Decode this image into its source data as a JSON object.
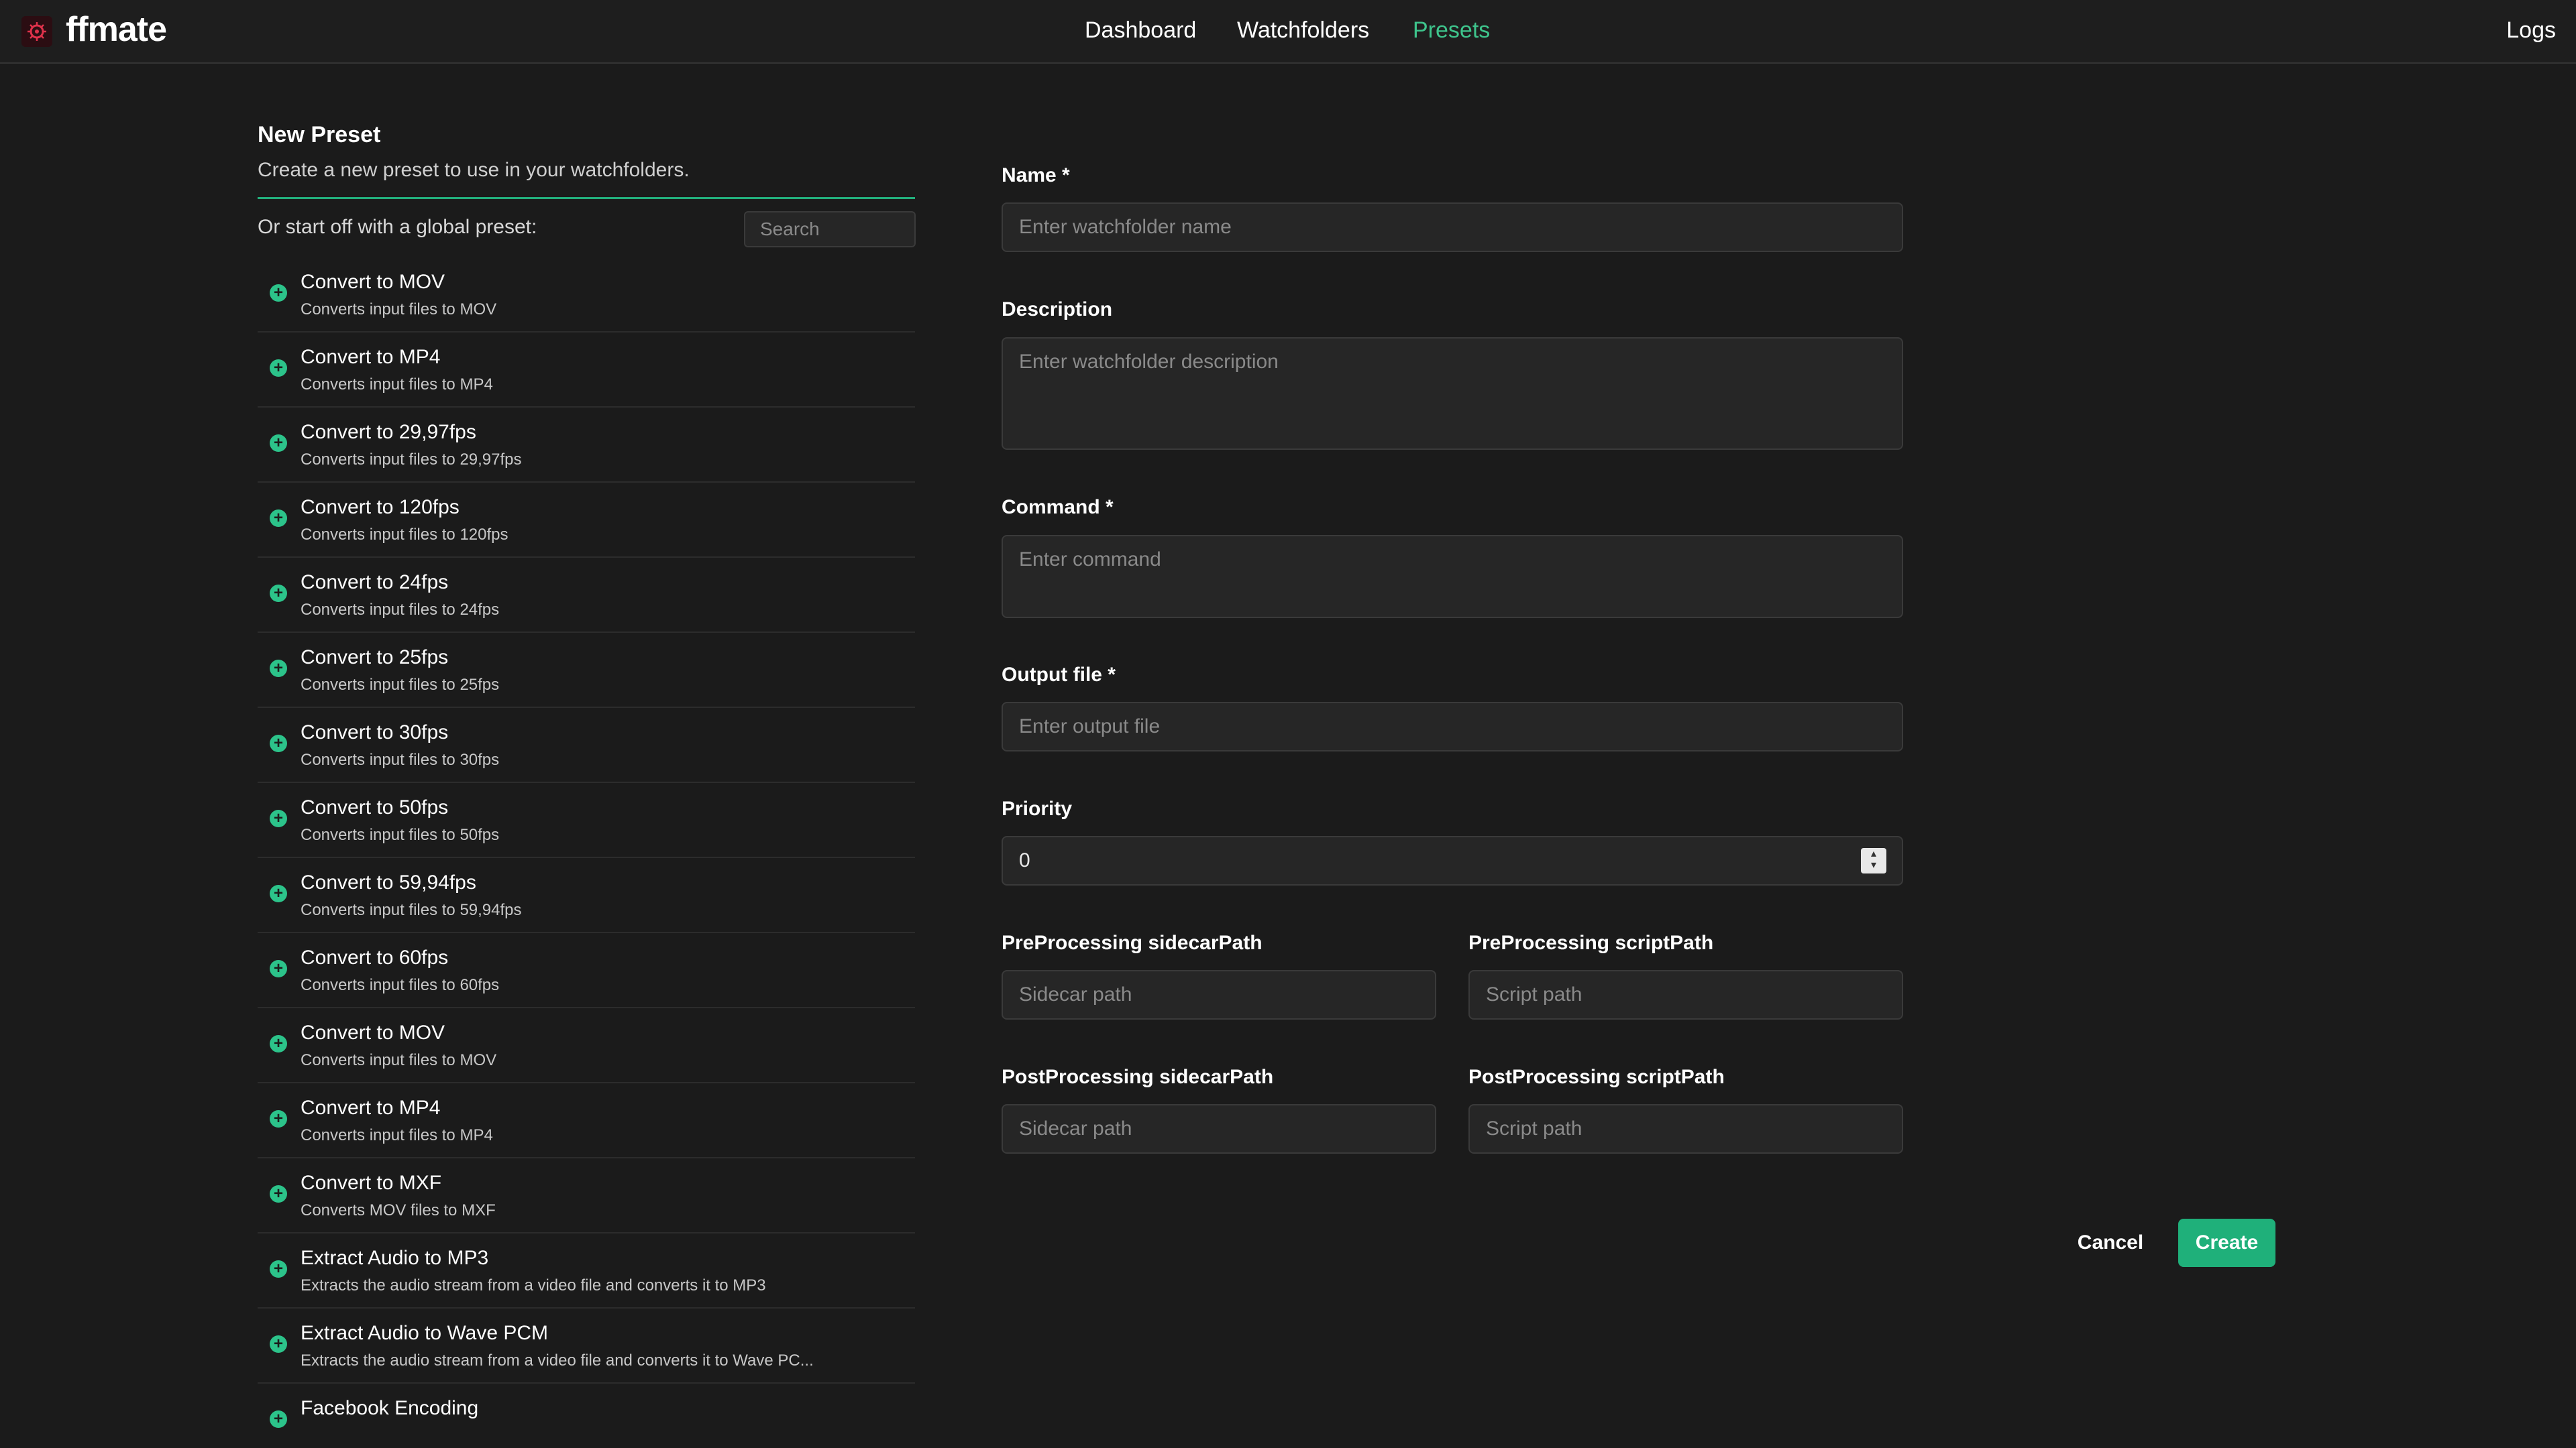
{
  "header": {
    "logo_text": "ffmate",
    "nav": [
      "Dashboard",
      "Watchfolders",
      "Presets"
    ],
    "active_nav": "Presets",
    "logs_label": "Logs"
  },
  "left": {
    "title": "New Preset",
    "subtitle": "Create a new preset to use in your watchfolders.",
    "global_label": "Or start off with a global preset:",
    "search_placeholder": "Search",
    "presets": [
      {
        "title": "Convert to MOV",
        "desc": "Converts input files to MOV"
      },
      {
        "title": "Convert to MP4",
        "desc": "Converts input files to MP4"
      },
      {
        "title": "Convert to 29,97fps",
        "desc": "Converts input files to 29,97fps"
      },
      {
        "title": "Convert to 120fps",
        "desc": "Converts input files to 120fps"
      },
      {
        "title": "Convert to 24fps",
        "desc": "Converts input files to 24fps"
      },
      {
        "title": "Convert to 25fps",
        "desc": "Converts input files to 25fps"
      },
      {
        "title": "Convert to 30fps",
        "desc": "Converts input files to 30fps"
      },
      {
        "title": "Convert to 50fps",
        "desc": "Converts input files to 50fps"
      },
      {
        "title": "Convert to 59,94fps",
        "desc": "Converts input files to 59,94fps"
      },
      {
        "title": "Convert to 60fps",
        "desc": "Converts input files to 60fps"
      },
      {
        "title": "Convert to MOV",
        "desc": "Converts input files to MOV"
      },
      {
        "title": "Convert to MP4",
        "desc": "Converts input files to MP4"
      },
      {
        "title": "Convert to MXF",
        "desc": "Converts MOV files to MXF"
      },
      {
        "title": "Extract Audio to MP3",
        "desc": "Extracts the audio stream from a video file and converts it to MP3"
      },
      {
        "title": "Extract Audio to Wave PCM",
        "desc": "Extracts the audio stream from a video file and converts it to Wave PC..."
      },
      {
        "title": "Facebook Encoding",
        "desc": ""
      }
    ]
  },
  "form": {
    "name_label": "Name *",
    "name_placeholder": "Enter watchfolder name",
    "description_label": "Description",
    "description_placeholder": "Enter watchfolder description",
    "command_label": "Command *",
    "command_placeholder": "Enter command",
    "output_label": "Output file *",
    "output_placeholder": "Enter output file",
    "priority_label": "Priority",
    "priority_value": "0",
    "pre_sidecar_label": "PreProcessing sidecarPath",
    "pre_script_label": "PreProcessing scriptPath",
    "post_sidecar_label": "PostProcessing sidecarPath",
    "post_script_label": "PostProcessing scriptPath",
    "sidecar_placeholder": "Sidecar path",
    "script_placeholder": "Script path",
    "cancel_label": "Cancel",
    "create_label": "Create"
  },
  "colors": {
    "accent": "#22b07d",
    "background": "#1b1b1b"
  }
}
